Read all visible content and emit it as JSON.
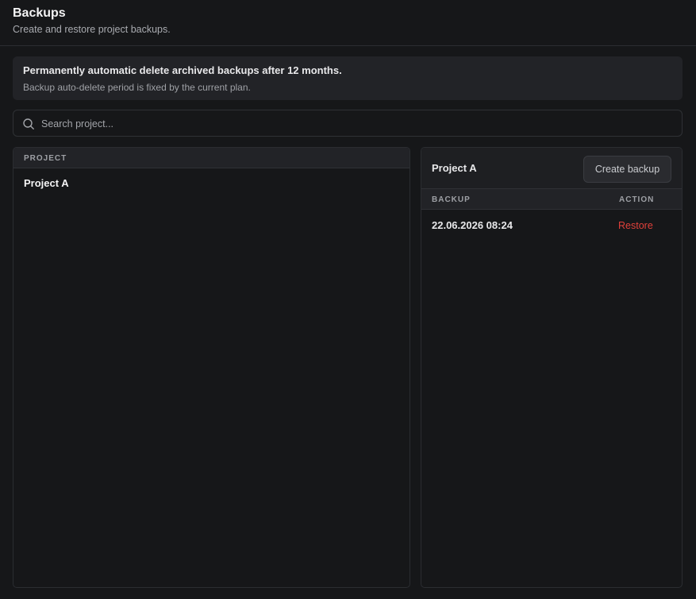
{
  "header": {
    "title": "Backups",
    "subtitle": "Create and restore project backups."
  },
  "notice": {
    "title": "Permanently automatic delete archived backups after 12 months.",
    "subtitle": "Backup auto-delete period is fixed by the current plan."
  },
  "search": {
    "placeholder": "Search project...",
    "value": ""
  },
  "projects": {
    "column_header": "PROJECT",
    "items": [
      {
        "name": "Project A"
      }
    ]
  },
  "detail": {
    "project_name": "Project A",
    "create_button": "Create backup",
    "columns": {
      "backup": "BACKUP",
      "action": "ACTION"
    },
    "backups": [
      {
        "date": "22.06.2026 08:24",
        "action": "Restore"
      }
    ]
  },
  "colors": {
    "background": "#161719",
    "panel_header": "#222327",
    "border": "#2b2d31",
    "danger": "#e0403a"
  },
  "icons": {
    "search": "search-icon"
  }
}
